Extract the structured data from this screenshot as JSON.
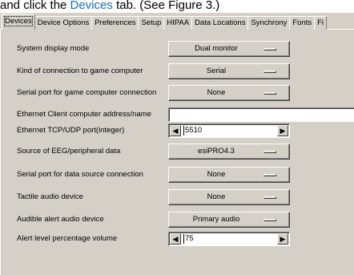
{
  "caption": {
    "prefix": "and click the ",
    "tab_ref": "Devices",
    "suffix": " tab. (See Figure 3.)"
  },
  "tabs": [
    "Devices",
    "Device Options",
    "Preferences",
    "Setup",
    "HIPAA",
    "Data Locations",
    "Synchrony",
    "Fonts",
    "Fi"
  ],
  "active_tab": "Devices",
  "fields": {
    "display_mode": {
      "label": "System display mode",
      "value": "Dual monitor"
    },
    "connection": {
      "label": "Kind of connection to game computer",
      "value": "Serial"
    },
    "serial_game": {
      "label": "Serial port for game computer connection",
      "value": "None"
    },
    "ethernet_address": {
      "label": "Ethernet Client computer address/name",
      "value": ""
    },
    "ethernet_port": {
      "label": "Ethernet TCP/UDP port(integer)",
      "value": "5510"
    },
    "eeg_source": {
      "label": "Source of EEG/peripheral data",
      "value": "esiPRO4.3"
    },
    "serial_data": {
      "label": "Serial port for data source connection",
      "value": "None"
    },
    "tactile": {
      "label": "Tactile audio device",
      "value": "None"
    },
    "alert_device": {
      "label": "Audible alert audio device",
      "value": "Primary audio"
    },
    "alert_volume": {
      "label": "Alert level percentage volume",
      "value": "75"
    }
  },
  "icons": {
    "spin_left": "◀",
    "spin_right": "▶"
  }
}
